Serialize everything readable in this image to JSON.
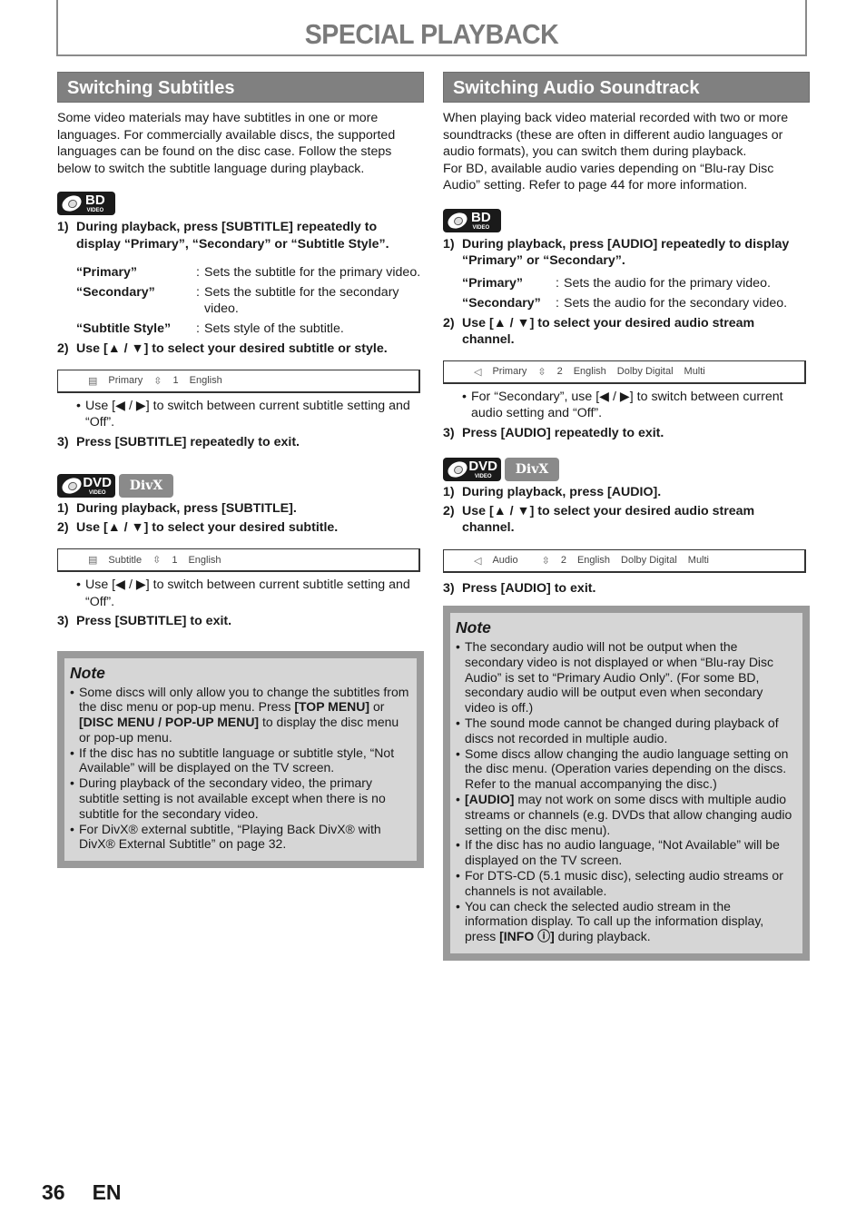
{
  "page_title": "SPECIAL PLAYBACK",
  "subtitles": {
    "heading": "Switching Subtitles",
    "intro": "Some video materials may have subtitles in one or more languages. For commercially available discs, the supported languages can be found on the disc case. Follow the steps below to switch the subtitle language during playback.",
    "bd": {
      "badges": [
        {
          "icon": "bd-video-disc-icon",
          "big": "BD",
          "small": "VIDEO"
        }
      ],
      "steps": [
        {
          "num": "1)",
          "text": "During playback, press [SUBTITLE] repeatedly to display “Primary”, “Secondary” or “Subtitle Style”."
        }
      ],
      "definitions": [
        {
          "term": "“Primary”",
          "desc": "Sets the subtitle for the primary video."
        },
        {
          "term": "“Secondary”",
          "desc": "Sets the subtitle for the secondary video."
        },
        {
          "term": "“Subtitle Style”",
          "desc": "Sets style of the subtitle."
        }
      ],
      "step2": {
        "num": "2)",
        "text": "Use [▲ / ▼] to select your desired subtitle or style."
      },
      "osd": {
        "icon": "▤",
        "label": "Primary",
        "updown": "⇳",
        "index": "1",
        "lang": "English"
      },
      "bullet": "Use [◀ / ▶] to switch between current subtitle setting and “Off”.",
      "step3": {
        "num": "3)",
        "text": "Press [SUBTITLE] repeatedly to exit."
      }
    },
    "dvd": {
      "badges": [
        {
          "icon": "dvd-video-disc-icon",
          "big": "DVD",
          "small": "VIDEO"
        },
        {
          "icon": "divx-logo",
          "text": "DivX"
        }
      ],
      "step1": {
        "num": "1)",
        "text": "During playback, press [SUBTITLE]."
      },
      "step2": {
        "num": "2)",
        "text": "Use [▲ / ▼] to select your desired subtitle."
      },
      "osd": {
        "icon": "▤",
        "label": "Subtitle",
        "updown": "⇳",
        "index": "1",
        "lang": "English"
      },
      "bullet": "Use [◀ / ▶] to switch between current subtitle setting and “Off”.",
      "step3": {
        "num": "3)",
        "text": "Press [SUBTITLE] to exit."
      }
    },
    "note": {
      "title": "Note",
      "items": [
        {
          "pre": "Some discs will only allow you to change the subtitles from the disc menu or pop-up menu. Press ",
          "b1": "[TOP MENU]",
          "mid": " or ",
          "b2": "[DISC MENU / POP-UP MENU]",
          "post": " to display the disc menu or pop-up menu."
        },
        {
          "text": "If the disc has no subtitle language or subtitle style, “Not Available” will be displayed on the TV screen."
        },
        {
          "text": "During playback of the secondary video, the primary subtitle setting is not available except when there is no subtitle for the secondary video."
        },
        {
          "text": "For DivX® external subtitle, “Playing Back DivX® with DivX® External Subtitle” on page 32."
        }
      ]
    }
  },
  "audio": {
    "heading": "Switching Audio Soundtrack",
    "intro1": "When playing back video material recorded with two or more soundtracks (these are often in different audio languages or audio formats), you can switch them during playback.",
    "intro2": "For BD, available audio varies depending on “Blu-ray Disc Audio” setting. Refer to page 44 for more information.",
    "bd": {
      "step1": {
        "num": "1)",
        "text": "During playback, press [AUDIO] repeatedly to display “Primary” or “Secondary”."
      },
      "definitions": [
        {
          "term": "“Primary”",
          "desc": "Sets the audio for the primary video."
        },
        {
          "term": "“Secondary”",
          "desc": "Sets the audio for the secondary video."
        }
      ],
      "step2": {
        "num": "2)",
        "text": "Use [▲ / ▼] to select your desired audio stream channel."
      },
      "osd": {
        "icon": "◁",
        "label": "Primary",
        "updown": "⇳",
        "index": "2",
        "lang": "English",
        "format": "Dolby Digital",
        "channels": "Multi"
      },
      "bullet": "For “Secondary”, use [◀ / ▶] to switch between current audio setting and “Off”.",
      "step3": {
        "num": "3)",
        "text": "Press [AUDIO] repeatedly to exit."
      }
    },
    "dvd": {
      "step1": {
        "num": "1)",
        "text": "During playback, press [AUDIO]."
      },
      "step2": {
        "num": "2)",
        "text": "Use [▲ / ▼] to select your desired audio stream channel."
      },
      "osd": {
        "icon": "◁",
        "label": "Audio",
        "updown": "⇳",
        "index": "2",
        "lang": "English",
        "format": "Dolby Digital",
        "channels": "Multi"
      },
      "step3": {
        "num": "3)",
        "text": "Press [AUDIO] to exit."
      }
    },
    "note": {
      "title": "Note",
      "items": [
        {
          "text": "The secondary audio will not be output when the secondary video is not displayed or when “Blu-ray Disc Audio” is set to “Primary Audio Only”. (For some BD, secondary audio will be output even when secondary video is off.)"
        },
        {
          "text": "The sound mode cannot be changed during playback of discs not recorded in multiple audio."
        },
        {
          "text": "Some discs allow changing the audio language setting on the disc menu. (Operation varies depending on the discs. Refer to the manual accompanying the disc.)"
        },
        {
          "b1": "[AUDIO]",
          "post": " may not work on some discs with multiple audio streams or channels (e.g. DVDs that allow changing audio setting on the disc menu)."
        },
        {
          "text": "If the disc has no audio language, “Not Available” will be displayed on the TV screen."
        },
        {
          "text": "For DTS-CD (5.1 music disc), selecting audio streams or channels is not available."
        },
        {
          "pre": "You can check the selected audio stream in the information display. To call up the information display, press ",
          "b1": "[INFO ⓘ]",
          "post": " during playback."
        }
      ]
    }
  },
  "footer": {
    "page_number": "36",
    "language": "EN"
  },
  "badge_labels": {
    "bd": "BD",
    "dvd": "DVD",
    "video": "VIDEO",
    "divx": "DivX",
    "bullet": "•"
  }
}
